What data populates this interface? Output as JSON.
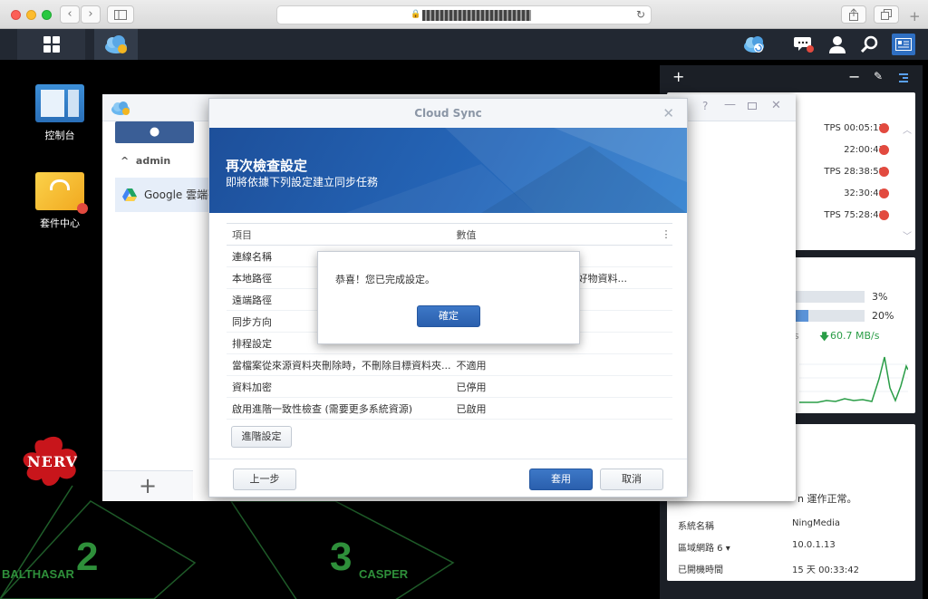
{
  "browser": {
    "reload_glyph": "↻"
  },
  "taskbar": {
    "icons": [
      "main-menu-icon",
      "cloud-sync-app-icon",
      "notification-icon",
      "chat-icon",
      "user-icon",
      "search-icon",
      "widgets-icon"
    ]
  },
  "desktop": {
    "icons": [
      {
        "label": "控制台"
      },
      {
        "label": "套件中心"
      }
    ],
    "wallpaper_text": {
      "nerv": "NERV",
      "balthasar_num": "2",
      "balthasar": "BALTHASAR",
      "casper_num": "3",
      "casper": "CASPER"
    }
  },
  "package_window": {
    "admin_label": "admin",
    "task_name": "Google 雲端硬",
    "plus": "+"
  },
  "widget_panel": {
    "toolbar": {
      "add": "+",
      "minimize": "−",
      "pin": "📌"
    },
    "connections": [
      {
        "time": "TPS 00:05:17"
      },
      {
        "time": "22:00:43"
      },
      {
        "time": "TPS 28:38:59"
      },
      {
        "time": "32:30:49"
      },
      {
        "time": "TPS 75:28:41"
      }
    ],
    "resource": {
      "cpu_pct": "3%",
      "ram_pct": "20%",
      "cpu_fill": 0.03,
      "ram_fill": 0.2,
      "network_download": "60.7 MB/s",
      "volume_suffix": "%)"
    },
    "health": {
      "status": "n 運作正常。",
      "rows": [
        {
          "label": "系統名稱",
          "value": "NingMedia"
        },
        {
          "label": "區域網路 6 ▾",
          "value": "10.0.1.13"
        },
        {
          "label": "已開機時間",
          "value": "15 天 00:33:42"
        }
      ]
    },
    "colors": {
      "remove_red": "#e24a3f",
      "graph_green": "#2a9d47"
    }
  },
  "dialog": {
    "title": "Cloud Sync",
    "close": "✕",
    "banner_title": "再次檢查設定",
    "banner_subtitle": "即將依據下列設定建立同步任務",
    "columns": {
      "item": "項目",
      "value": "數值"
    },
    "rows": [
      {
        "item": "連線名稱",
        "value": ""
      },
      {
        "item": "本地路徑",
        "value": ""
      },
      {
        "item": "遠端路徑",
        "value": ""
      },
      {
        "item": "同步方向",
        "value": ""
      },
      {
        "item": "排程設定",
        "value": ""
      },
      {
        "item": "當檔案從來源資料夾刪除時，不刪除目標資料夾...",
        "value": "不適用"
      },
      {
        "item": "資料加密",
        "value": "已停用"
      },
      {
        "item": "啟用進階一致性檢查 (需要更多系統資源)",
        "value": "已啟用"
      }
    ],
    "row2_partial": "案可好物資料...",
    "advanced_button": "進階設定",
    "back_button": "上一步",
    "apply_button": "套用",
    "cancel_button": "取消"
  },
  "alert": {
    "message": "恭喜！您已完成設定。",
    "ok_button": "確定"
  }
}
